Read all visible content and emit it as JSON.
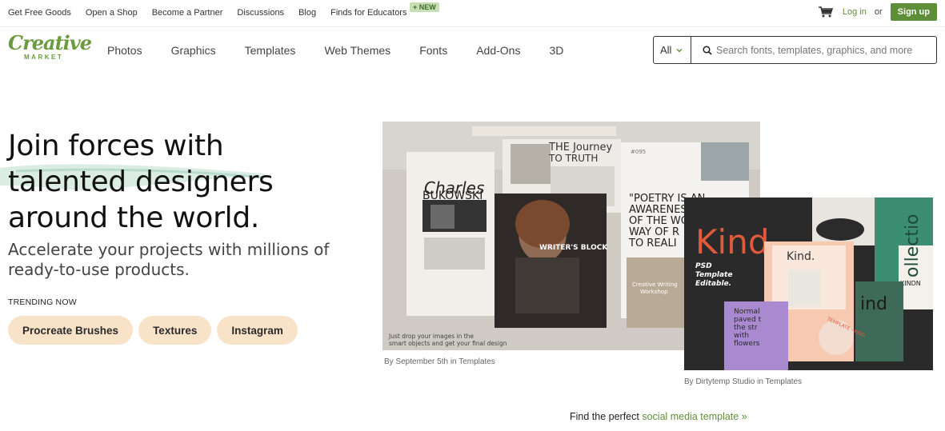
{
  "topbar": {
    "links": [
      "Get Free Goods",
      "Open a Shop",
      "Become a Partner",
      "Discussions",
      "Blog",
      "Finds for Educators"
    ],
    "new_badge": "+ NEW",
    "login": "Log in",
    "or": "or",
    "signup": "Sign up"
  },
  "logo": {
    "line1": "Creative",
    "line2": "MARKET"
  },
  "nav": {
    "items": [
      "Photos",
      "Graphics",
      "Templates",
      "Web Themes",
      "Fonts",
      "Add-Ons",
      "3D"
    ]
  },
  "search": {
    "category": "All",
    "placeholder": "Search fonts, templates, graphics, and more"
  },
  "hero": {
    "headline": [
      "Join forces with",
      "talented designers",
      "around the world."
    ],
    "subheading": [
      "Accelerate your projects with millions of",
      "ready-to-use products."
    ],
    "trending_label": "TRENDING NOW",
    "trending": [
      "Procreate Brushes",
      "Textures",
      "Instagram"
    ]
  },
  "showcase": {
    "card1": {
      "caption": "By September 5th in Templates",
      "charles": "Charles",
      "bukowski": "BUKOWSKI",
      "journey_a": "THE Journey",
      "journey_b": "TO TRUTH",
      "writers_block": "WRITER'S BLOCK",
      "poetry": [
        "\"POETRY IS AN",
        "AWARENESS",
        "OF THE WORLD",
        "WAY OF R",
        "TO REALI"
      ],
      "number": "#095",
      "creative_writing": "Creative Writing",
      "workshop": "Workshop",
      "footer_note": [
        "Just drop your images in the",
        "smart objects and get your final design"
      ]
    },
    "card2": {
      "caption": "By Dirtytemp Studio in Templates",
      "kind_big": "Kind.",
      "kind_small": "Kind.",
      "psd": [
        "PSD",
        "Template",
        "Editable."
      ],
      "collection": "ollectio",
      "kinds": "KINDN",
      "ind": "ind",
      "normal": [
        "Normal",
        "paved t",
        "the str",
        "with",
        "flowers"
      ],
      "ring": "TEMPLATE - KIND"
    }
  },
  "bottom": {
    "prefix": "Find the perfect",
    "link": "social media template »"
  },
  "colors": {
    "brand_green": "#5f8e3b",
    "pill": "#f9e3c8",
    "kind_red": "#e05a3b"
  }
}
